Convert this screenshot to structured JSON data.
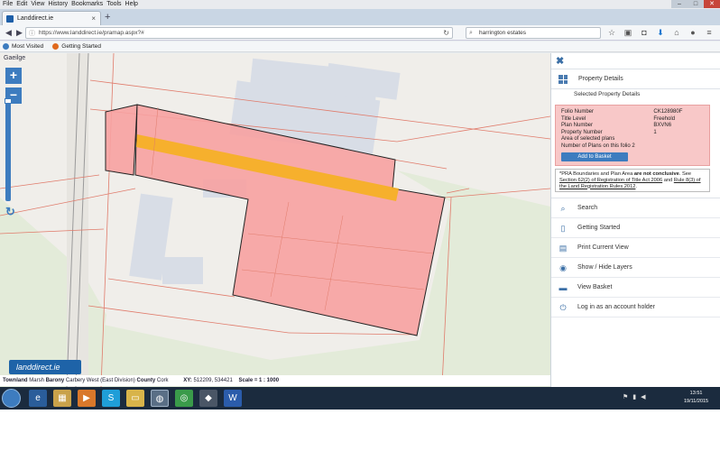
{
  "menubar": {
    "items": [
      "File",
      "Edit",
      "View",
      "History",
      "Bookmarks",
      "Tools",
      "Help"
    ],
    "window_controls": [
      "minimize-icon",
      "maximize-icon",
      "close-icon"
    ]
  },
  "tabs": {
    "active_label": "Landdirect.ie",
    "close": "×",
    "new_tab": "+"
  },
  "navbar": {
    "url": "https://www.landdirect.ie/pramap.aspx?#",
    "search_value": "harrington estates",
    "icons": [
      "back-icon",
      "forward-icon",
      "lock-icon",
      "reload-icon",
      "star-icon",
      "clipboard-icon",
      "pocket-icon",
      "download-icon",
      "home-icon",
      "chat-icon",
      "menu-icon"
    ]
  },
  "bookmarks": [
    {
      "label": "Most Visited",
      "color": "#3d7cbf"
    },
    {
      "label": "Getting Started",
      "color": "#e06a1e"
    }
  ],
  "map": {
    "language_link": "Gaeilge",
    "zoom_in": "+",
    "zoom_out": "−",
    "refresh": "↻",
    "logo_text": "landdirect.ie",
    "colors": {
      "highlight": "#f7a1a1",
      "road": "#f5b026",
      "building": "#d8dde6",
      "grass": "#e3ebd9"
    }
  },
  "status": {
    "townland_label": "Townland",
    "townland_value": "Marsh",
    "barony_label": "Barony",
    "barony_value": "Carbery West (East Division)",
    "county_label": "County",
    "county_value": "Cork",
    "xy_label": "XY:",
    "xy_value": "512209, 534421",
    "scale_label": "Scale = 1 : 1000"
  },
  "panel": {
    "close_icon": "✖",
    "header": "Property Details",
    "subheader": "Selected Property Details",
    "details": [
      {
        "label": "Folio Number",
        "value": "CK128980F"
      },
      {
        "label": "Title Level",
        "value": "Freehold"
      },
      {
        "label": "Plan Number",
        "value": "BXVN6"
      },
      {
        "label": "Property Number",
        "value": "1"
      },
      {
        "label": "Area of selected plans",
        "value": ""
      },
      {
        "label": "Number of Plans on this folio",
        "value": "2"
      }
    ],
    "add_basket": "Add to Basket",
    "note": {
      "p1": "*PRA Boundaries and Plan Area ",
      "p2": "are not conclusive",
      "p3": ". See ",
      "p4": "Section 62(2) of Registration of Title Act 2006",
      "p5": " and ",
      "p6": "Rule 8(3) of the Land Registration Rules 2012",
      "p7": "."
    },
    "menu": [
      {
        "icon": "search-icon",
        "label": "Search"
      },
      {
        "icon": "document-icon",
        "label": "Getting Started"
      },
      {
        "icon": "printer-icon",
        "label": "Print Current View"
      },
      {
        "icon": "eye-icon",
        "label": "Show / Hide Layers"
      },
      {
        "icon": "basket-icon",
        "label": "View Basket"
      },
      {
        "icon": "power-icon",
        "label": "Log in as an account holder"
      }
    ]
  },
  "taskbar": {
    "apps": [
      "ie-icon",
      "explorer-icon",
      "media-icon",
      "skype-icon",
      "folder-icon",
      "firefox-icon",
      "chrome-icon",
      "app-icon",
      "word-icon"
    ],
    "time": "13:51",
    "date": "19/11/2015"
  }
}
